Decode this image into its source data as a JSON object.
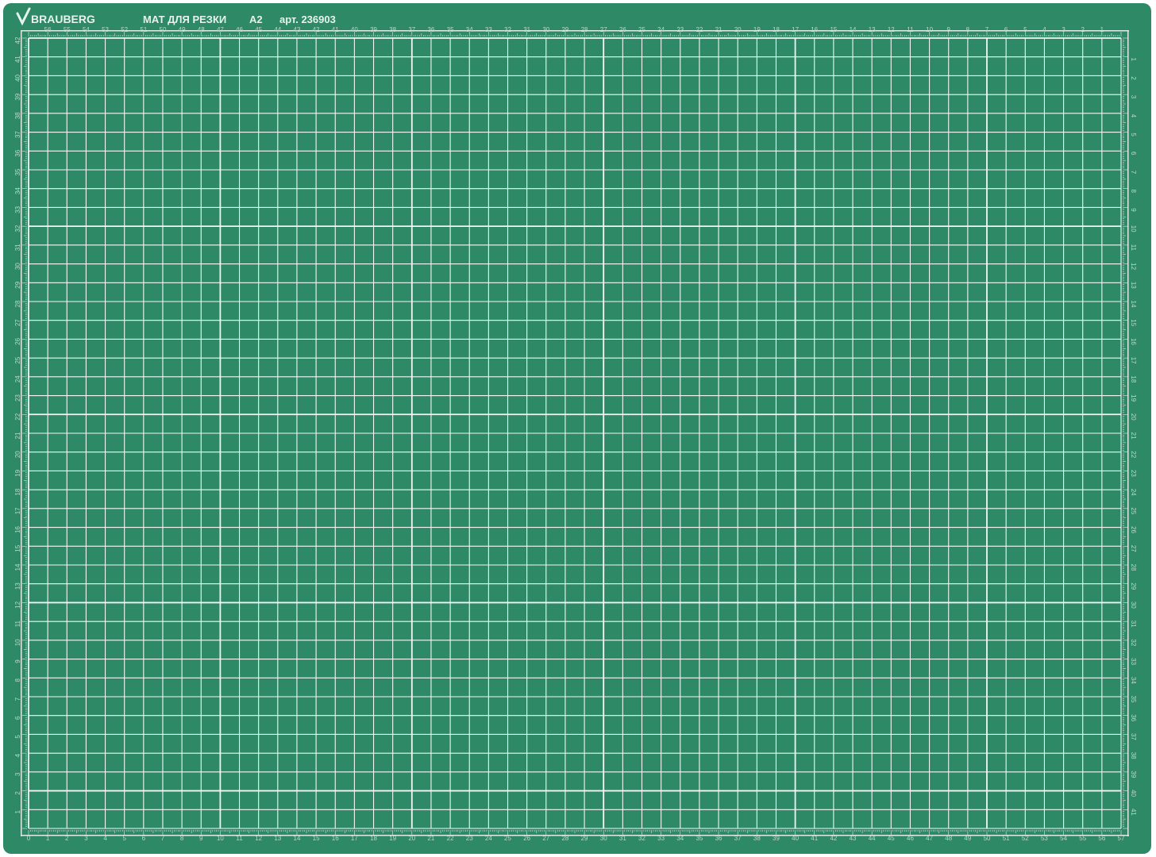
{
  "brand": {
    "name": "BRAUBERG",
    "logo_icon": "checkmark-icon"
  },
  "header": {
    "product_name": "МАТ ДЛЯ РЕЗКИ",
    "size": "A2",
    "article": "арт. 236903"
  },
  "colors": {
    "mat_green": "#2e8a66",
    "mat_edge": "#237256",
    "grid_line": "#f2f7f4",
    "ruler_strip": "#dfe9e4",
    "text_light": "#e6f3ec"
  },
  "grid": {
    "columns_cm": 57,
    "rows_cm": 42,
    "unit": "cm"
  },
  "rulers": {
    "top_start": 56,
    "top_end": 1,
    "bottom_start": 0,
    "bottom_end": 57,
    "left_start": 42,
    "left_end": 1,
    "right_start": 1,
    "right_end": 41
  }
}
